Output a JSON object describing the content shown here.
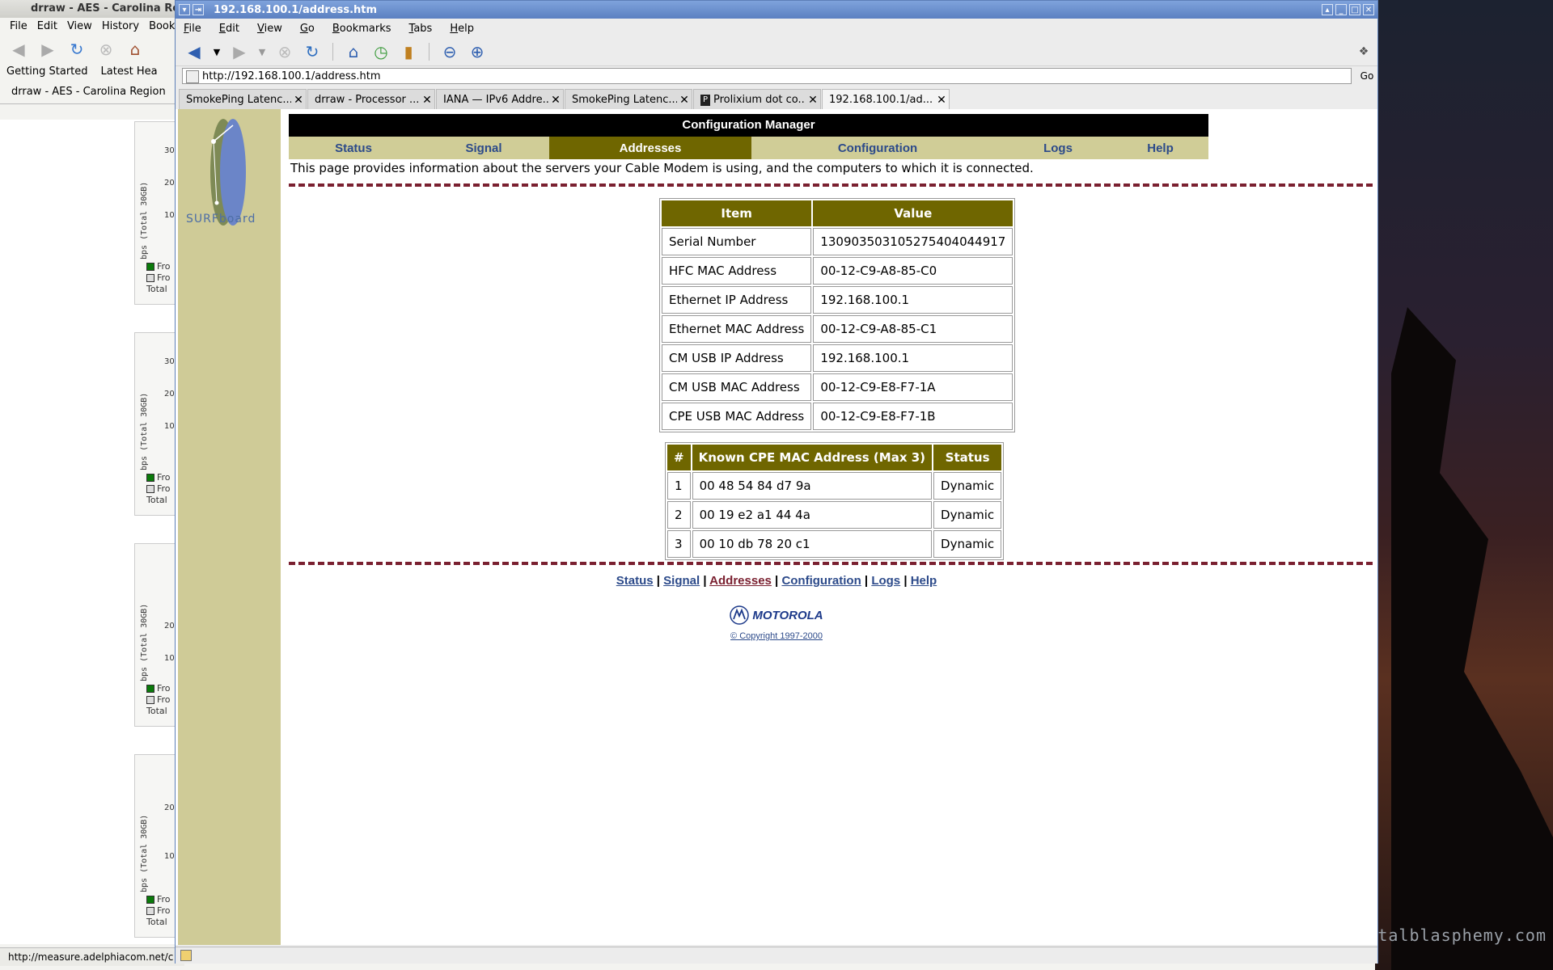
{
  "desktop": {
    "watermark": "igitalblasphemy.com"
  },
  "bg_window": {
    "title": "drraw - AES - Carolina Re",
    "menu": [
      "File",
      "Edit",
      "View",
      "History",
      "Bookr"
    ],
    "bookmarks": [
      "Getting Started",
      "Latest Hea"
    ],
    "tab": "drraw - AES - Carolina Region",
    "graphs": [
      {
        "ylabel": "bps (Total 30GB)",
        "ticks": [
          "30",
          "20",
          "10"
        ],
        "legend": [
          "Fro",
          "Fro",
          "Total"
        ]
      },
      {
        "ylabel": "bps (Total 30GB)",
        "ticks": [
          "30",
          "20",
          "10"
        ],
        "legend": [
          "Fro",
          "Fro",
          "Total"
        ]
      },
      {
        "ylabel": "bps (Total 30GB)",
        "ticks": [
          "20",
          "10"
        ],
        "legend": [
          "Fro",
          "Fro",
          "Total"
        ]
      },
      {
        "ylabel": "bps (Total 30GB)",
        "ticks": [
          "20",
          "10"
        ],
        "legend": [
          "Fro",
          "Fro",
          "Total"
        ]
      }
    ],
    "status": "http://measure.adelphiacom.net/c"
  },
  "window": {
    "title": "192.168.100.1/address.htm",
    "menu": [
      "File",
      "Edit",
      "View",
      "Go",
      "Bookmarks",
      "Tabs",
      "Help"
    ],
    "url": "http://192.168.100.1/address.htm",
    "go_label": "Go",
    "tabs": [
      "SmokePing Latenc...",
      "drraw - Processor ...",
      "IANA — IPv6 Addre...",
      "SmokePing Latenc...",
      "Prolixium dot co...",
      "192.168.100.1/ad..."
    ]
  },
  "page": {
    "logo_text": "SURFboard",
    "header": "Configuration Manager",
    "nav": [
      "Status",
      "Signal",
      "Addresses",
      "Configuration",
      "Logs",
      "Help"
    ],
    "active_nav": "Addresses",
    "intro": "This page provides information about the servers your Cable Modem is using, and the computers to which it is connected.",
    "info_table": {
      "headers": [
        "Item",
        "Value"
      ],
      "rows": [
        [
          "Serial Number",
          "130903503105275404044917"
        ],
        [
          "HFC MAC Address",
          "00-12-C9-A8-85-C0"
        ],
        [
          "Ethernet IP Address",
          "192.168.100.1"
        ],
        [
          "Ethernet MAC Address",
          "00-12-C9-A8-85-C1"
        ],
        [
          "CM USB IP Address",
          "192.168.100.1"
        ],
        [
          "CM USB MAC Address",
          "00-12-C9-E8-F7-1A"
        ],
        [
          "CPE USB MAC Address",
          "00-12-C9-E8-F7-1B"
        ]
      ]
    },
    "cpe_table": {
      "headers": [
        "#",
        "Known CPE MAC Address (Max 3)",
        "Status"
      ],
      "rows": [
        [
          "1",
          "00 48 54 84 d7 9a",
          "Dynamic"
        ],
        [
          "2",
          "00 19 e2 a1 44 4a",
          "Dynamic"
        ],
        [
          "3",
          "00 10 db 78 20 c1",
          "Dynamic"
        ]
      ]
    },
    "footer_links": [
      "Status",
      "Signal",
      "Addresses",
      "Configuration",
      "Logs",
      "Help"
    ],
    "brand": "MOTOROLA",
    "copyright": "© Copyright 1997-2000"
  },
  "colors": {
    "olive": "#6f6600",
    "khaki": "#d0cd97",
    "link": "#2c4a8a",
    "dash": "#7a2030"
  }
}
